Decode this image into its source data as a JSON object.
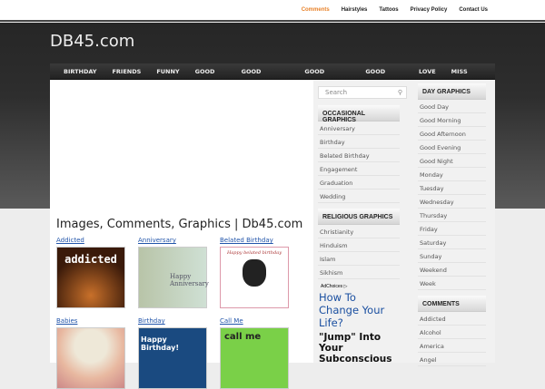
{
  "top_links": [
    "Comments",
    "Hairstyles",
    "Tattoos",
    "Privacy Policy",
    "Contact Us"
  ],
  "site_title": "DB45.com",
  "nav": [
    "BIRTHDAY",
    "FRIENDS",
    "FUNNY",
    "GOOD DAY",
    "GOOD MORNING",
    "GOOD EVENING",
    "GOOD NIGHT",
    "LOVE",
    "MISS YOU"
  ],
  "page_heading": "Images, Comments, Graphics | Db45.com",
  "thumbnails": [
    {
      "label": "Addicted",
      "text": "addicted"
    },
    {
      "label": "Anniversary",
      "text": "Happy Anniversary"
    },
    {
      "label": "Belated Birthday",
      "text": "Happy belated birthday"
    },
    {
      "label": "Babies",
      "text": ""
    },
    {
      "label": "Birthday",
      "text": "Happy Birthday!"
    },
    {
      "label": "Call Me",
      "text": "call me"
    }
  ],
  "search_placeholder": "Search",
  "occasional": {
    "title": "OCCASIONAL GRAPHICS",
    "items": [
      "Anniversary",
      "Birthday",
      "Belated Birthday",
      "Engagement",
      "Graduation",
      "Wedding"
    ]
  },
  "religious": {
    "title": "RELIGIOUS GRAPHICS",
    "items": [
      "Christianity",
      "Hinduism",
      "Islam",
      "Sikhism"
    ]
  },
  "ad": {
    "choices": "AdChoices ▷",
    "headline": "How To Change Your Life?",
    "body": "\"Jump\" Into Your Subconscious"
  },
  "day": {
    "title": "DAY GRAPHICS",
    "items": [
      "Good Day",
      "Good Morning",
      "Good Afternoon",
      "Good Evening",
      "Good Night",
      "Monday",
      "Tuesday",
      "Wednesday",
      "Thursday",
      "Friday",
      "Saturday",
      "Sunday",
      "Weekend",
      "Week"
    ]
  },
  "comments": {
    "title": "COMMENTS",
    "items": [
      "Addicted",
      "Alcohol",
      "America",
      "Angel"
    ]
  }
}
